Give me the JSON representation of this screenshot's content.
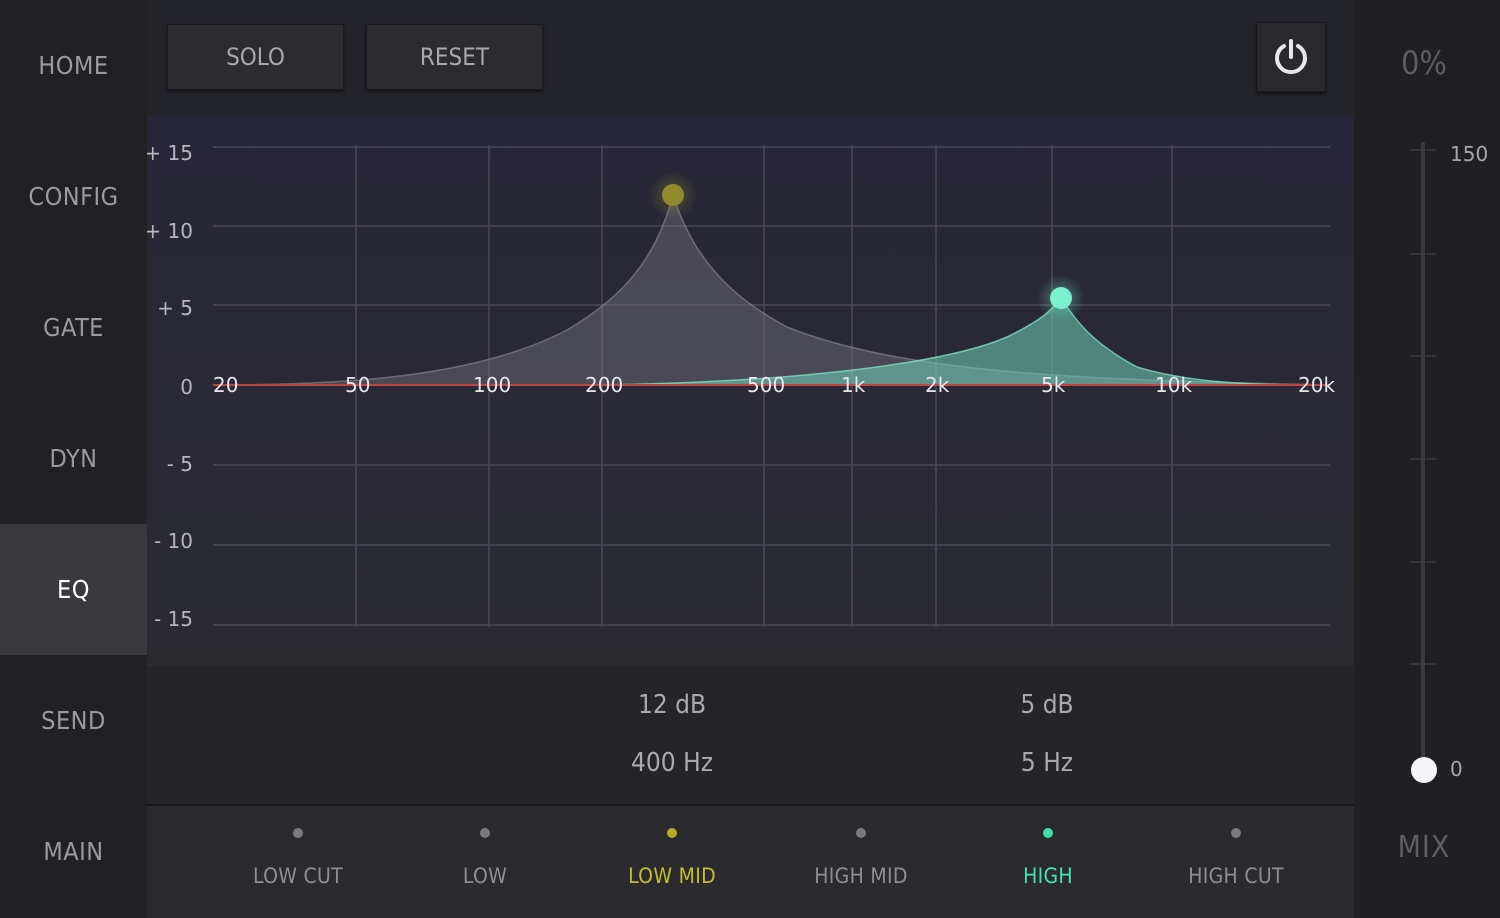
{
  "nav": {
    "items": [
      {
        "label": "HOME",
        "active": false
      },
      {
        "label": "CONFIG",
        "active": false
      },
      {
        "label": "GATE",
        "active": false
      },
      {
        "label": "DYN",
        "active": false
      },
      {
        "label": "EQ",
        "active": true
      },
      {
        "label": "SEND",
        "active": false
      },
      {
        "label": "MAIN",
        "active": false
      }
    ]
  },
  "toolbar": {
    "solo_label": "SOLO",
    "reset_label": "RESET",
    "power_icon": "power-icon"
  },
  "graph": {
    "y_labels": [
      "+ 15",
      "+ 10",
      "+ 5",
      "0",
      "- 5",
      "- 10",
      "- 15"
    ],
    "x_labels": [
      "20",
      "50",
      "100",
      "200",
      "500",
      "1k",
      "2k",
      "5k",
      "10k",
      "20k"
    ],
    "colors": {
      "low_mid": "#8f8a2a",
      "high": "#6fe8c6",
      "zero_line": "#c0443f"
    }
  },
  "readouts": {
    "low_mid": {
      "gain": "12 dB",
      "freq": "400 Hz"
    },
    "high": {
      "gain": "5 dB",
      "freq": "5 Hz"
    }
  },
  "bands": [
    {
      "label": "LOW CUT",
      "color": "#7a7a80",
      "text_color": "#8e8e94"
    },
    {
      "label": "LOW",
      "color": "#7a7a80",
      "text_color": "#8e8e94"
    },
    {
      "label": "LOW MID",
      "color": "#b3ad2b",
      "text_color": "#c4bd2f"
    },
    {
      "label": "HIGH MID",
      "color": "#7a7a80",
      "text_color": "#8e8e94"
    },
    {
      "label": "HIGH",
      "color": "#3ee0a8",
      "text_color": "#43e6b1"
    },
    {
      "label": "HIGH CUT",
      "color": "#7a7a80",
      "text_color": "#8e8e94"
    }
  ],
  "mix": {
    "percent": "0%",
    "label": "MIX",
    "scale_max": "150",
    "scale_min": "0",
    "value": 0
  }
}
